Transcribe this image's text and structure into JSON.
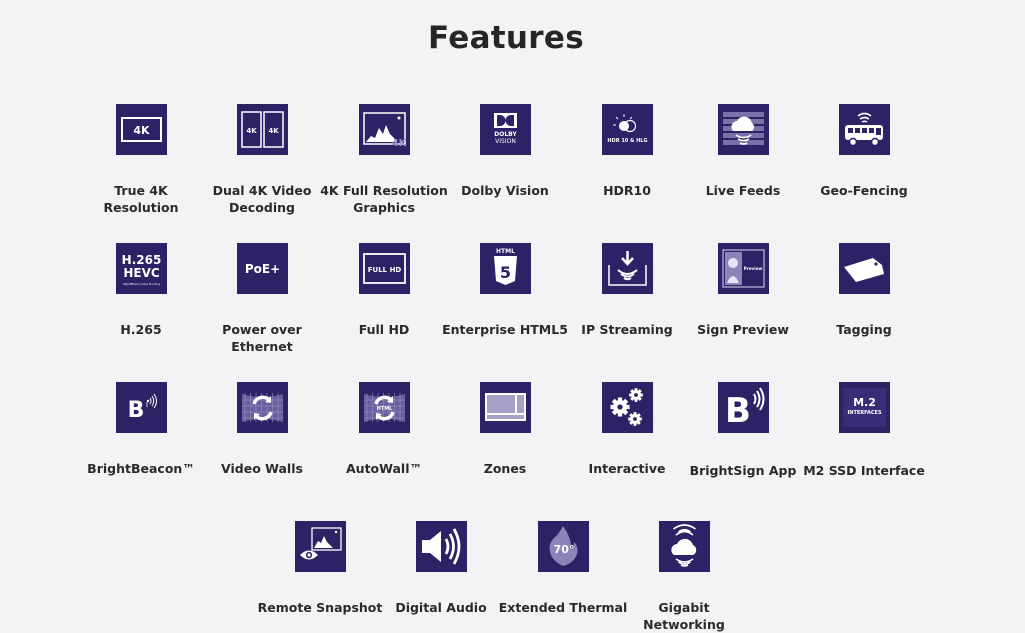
{
  "page": {
    "title": "Features"
  },
  "colors": {
    "tile": "#2e2166",
    "background": "#f1f3f5",
    "text": "#2a2a2a"
  },
  "features": [
    {
      "label": "True 4K Resolution",
      "icon": "4k-screen-icon",
      "icon_text": "4K"
    },
    {
      "label": "Dual 4K Video\nDecoding",
      "icon": "dual-4k-icon",
      "icon_text": "4K"
    },
    {
      "label": "4K Full Resolution\nGraphics",
      "icon": "4k-graphics-icon",
      "icon_text": "4K"
    },
    {
      "label": "Dolby Vision",
      "icon": "dolby-vision-icon",
      "icon_text": "DOLBY",
      "icon_text2": "VISION"
    },
    {
      "label": "HDR10",
      "icon": "hdr-icon",
      "icon_text": "HDR 10 & HLG"
    },
    {
      "label": "Live Feeds",
      "icon": "live-feeds-icon"
    },
    {
      "label": "Geo-Fencing",
      "icon": "geo-fencing-bus-icon"
    },
    {
      "label": "H.265",
      "icon": "hevc-icon",
      "icon_text": "H.265",
      "icon_text2": "HEVC",
      "icon_text3": "High Efficiency Video Encoding"
    },
    {
      "label": "Power over\nEthernet",
      "icon": "poe-icon",
      "icon_text": "PoE+"
    },
    {
      "label": "Full HD",
      "icon": "full-hd-icon",
      "icon_text": "FULL HD"
    },
    {
      "label": "Enterprise HTML5",
      "icon": "html5-icon",
      "icon_text": "HTML",
      "icon_text2": "5"
    },
    {
      "label": "IP Streaming",
      "icon": "ip-streaming-icon"
    },
    {
      "label": "Sign Preview",
      "icon": "sign-preview-icon",
      "icon_text": "Preview"
    },
    {
      "label": "Tagging",
      "icon": "tag-icon"
    },
    {
      "label": "BrightBeacon™",
      "icon": "brightbeacon-icon",
      "icon_text": "B"
    },
    {
      "label": "Video Walls",
      "icon": "video-wall-icon"
    },
    {
      "label": "AutoWall™",
      "icon": "autowall-icon",
      "icon_text": "HTML"
    },
    {
      "label": "Zones",
      "icon": "zones-icon"
    },
    {
      "label": "Interactive",
      "icon": "gears-icon"
    },
    {
      "label": "BrightSign App",
      "icon": "brightsign-app-icon",
      "icon_text": "B"
    },
    {
      "label": "M2 SSD Interface",
      "icon": "m2-ssd-icon",
      "icon_text": "M.2",
      "icon_text2": "INTERFACES"
    },
    {
      "label": "Remote Snapshot",
      "icon": "remote-snapshot-icon"
    },
    {
      "label": "Digital Audio",
      "icon": "speaker-icon"
    },
    {
      "label": "Extended Thermal",
      "icon": "thermal-flame-icon",
      "icon_text": "70°"
    },
    {
      "label": "Gigabit Networking",
      "icon": "gigabit-cloud-icon"
    }
  ]
}
